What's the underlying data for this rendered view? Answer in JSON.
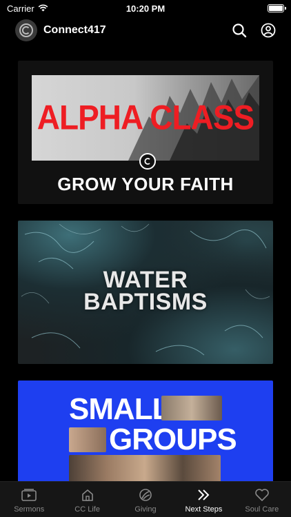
{
  "status": {
    "carrier": "Carrier",
    "time": "10:20 PM",
    "battery_level": 1.0
  },
  "header": {
    "title": "Connect417",
    "icons": [
      "search-icon",
      "profile-icon"
    ]
  },
  "cards": [
    {
      "title": "ALPHA CLASS",
      "subtitle": "GROW YOUR FAITH"
    },
    {
      "title_line1": "WATER",
      "title_line2": "BAPTISMS"
    },
    {
      "title_line1": "SMALL",
      "title_line2": "GROUPS"
    }
  ],
  "tabs": [
    {
      "label": "Sermons",
      "icon": "play-icon",
      "active": false
    },
    {
      "label": "CC Life",
      "icon": "home-icon",
      "active": false
    },
    {
      "label": "Giving",
      "icon": "giving-icon",
      "active": false
    },
    {
      "label": "Next Steps",
      "icon": "chevrons-icon",
      "active": true
    },
    {
      "label": "Soul Care",
      "icon": "heart-icon",
      "active": false
    }
  ],
  "colors": {
    "accent_red": "#ee1d23",
    "groups_blue": "#1e3ff0",
    "tab_inactive": "#8a8a8a"
  }
}
